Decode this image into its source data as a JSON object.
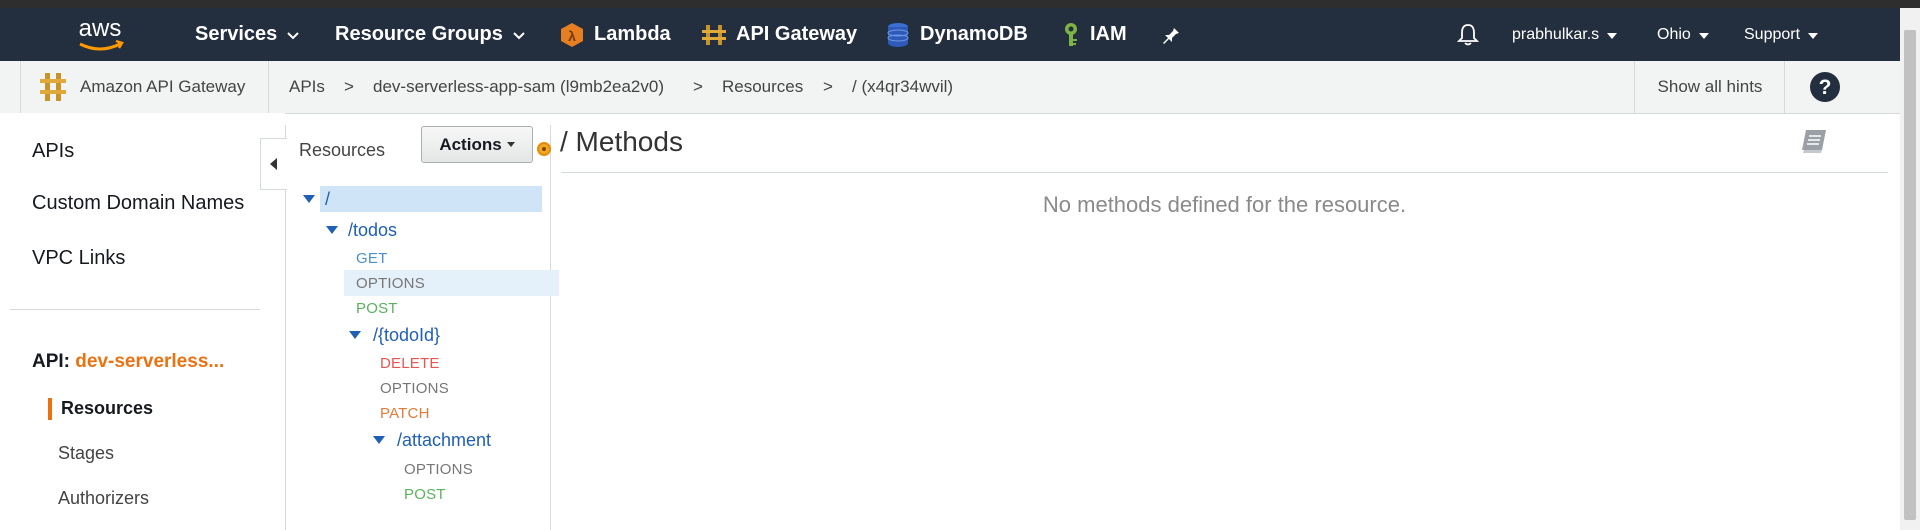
{
  "topnav": {
    "logo_text": "aws",
    "services": "Services",
    "resource_groups": "Resource Groups",
    "shortcuts": [
      {
        "label": "Lambda",
        "icon": "lambda-icon"
      },
      {
        "label": "API Gateway",
        "icon": "api-gateway-icon"
      },
      {
        "label": "DynamoDB",
        "icon": "dynamodb-icon"
      },
      {
        "label": "IAM",
        "icon": "iam-icon"
      }
    ],
    "pin_icon": "pin-icon",
    "bell_icon": "bell-icon",
    "user": "prabhulkar.s",
    "region": "Ohio",
    "support": "Support"
  },
  "breadcrumb": {
    "service": "Amazon API Gateway",
    "items": [
      "APIs",
      "dev-serverless-app-sam (l9mb2ea2v0)",
      "Resources",
      "/ (x4qr34wvil)"
    ],
    "separator": ">",
    "show_hints": "Show all hints",
    "help_icon": "help-icon"
  },
  "leftnav": {
    "links": [
      "APIs",
      "Custom Domain Names",
      "VPC Links"
    ],
    "api_prefix": "API:",
    "api_name": "dev-serverless...",
    "sub": [
      "Resources",
      "Stages",
      "Authorizers"
    ]
  },
  "tree": {
    "title": "Resources",
    "actions": "Actions",
    "rows": [
      {
        "kind": "resource",
        "label": "/"
      },
      {
        "kind": "resource",
        "label": "/todos"
      },
      {
        "kind": "method",
        "label": "GET"
      },
      {
        "kind": "method",
        "label": "OPTIONS"
      },
      {
        "kind": "method",
        "label": "POST"
      },
      {
        "kind": "resource",
        "label": "/{todoId}"
      },
      {
        "kind": "method",
        "label": "DELETE"
      },
      {
        "kind": "method",
        "label": "OPTIONS"
      },
      {
        "kind": "method",
        "label": "PATCH"
      },
      {
        "kind": "resource",
        "label": "/attachment"
      },
      {
        "kind": "method",
        "label": "OPTIONS"
      },
      {
        "kind": "method",
        "label": "POST"
      }
    ]
  },
  "main": {
    "title": "/ Methods",
    "empty_message": "No methods defined for the resource."
  },
  "colors": {
    "nav_bg": "#232f3e",
    "accent_orange": "#ec7211",
    "link_blue": "#1f5fb4"
  }
}
